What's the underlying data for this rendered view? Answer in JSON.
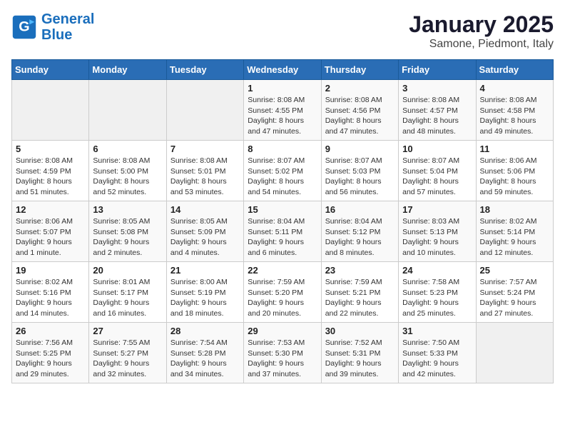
{
  "logo": {
    "line1": "General",
    "line2": "Blue"
  },
  "title": "January 2025",
  "subtitle": "Samone, Piedmont, Italy",
  "weekdays": [
    "Sunday",
    "Monday",
    "Tuesday",
    "Wednesday",
    "Thursday",
    "Friday",
    "Saturday"
  ],
  "weeks": [
    [
      {
        "day": "",
        "info": ""
      },
      {
        "day": "",
        "info": ""
      },
      {
        "day": "",
        "info": ""
      },
      {
        "day": "1",
        "info": "Sunrise: 8:08 AM\nSunset: 4:55 PM\nDaylight: 8 hours and 47 minutes."
      },
      {
        "day": "2",
        "info": "Sunrise: 8:08 AM\nSunset: 4:56 PM\nDaylight: 8 hours and 47 minutes."
      },
      {
        "day": "3",
        "info": "Sunrise: 8:08 AM\nSunset: 4:57 PM\nDaylight: 8 hours and 48 minutes."
      },
      {
        "day": "4",
        "info": "Sunrise: 8:08 AM\nSunset: 4:58 PM\nDaylight: 8 hours and 49 minutes."
      }
    ],
    [
      {
        "day": "5",
        "info": "Sunrise: 8:08 AM\nSunset: 4:59 PM\nDaylight: 8 hours and 51 minutes."
      },
      {
        "day": "6",
        "info": "Sunrise: 8:08 AM\nSunset: 5:00 PM\nDaylight: 8 hours and 52 minutes."
      },
      {
        "day": "7",
        "info": "Sunrise: 8:08 AM\nSunset: 5:01 PM\nDaylight: 8 hours and 53 minutes."
      },
      {
        "day": "8",
        "info": "Sunrise: 8:07 AM\nSunset: 5:02 PM\nDaylight: 8 hours and 54 minutes."
      },
      {
        "day": "9",
        "info": "Sunrise: 8:07 AM\nSunset: 5:03 PM\nDaylight: 8 hours and 56 minutes."
      },
      {
        "day": "10",
        "info": "Sunrise: 8:07 AM\nSunset: 5:04 PM\nDaylight: 8 hours and 57 minutes."
      },
      {
        "day": "11",
        "info": "Sunrise: 8:06 AM\nSunset: 5:06 PM\nDaylight: 8 hours and 59 minutes."
      }
    ],
    [
      {
        "day": "12",
        "info": "Sunrise: 8:06 AM\nSunset: 5:07 PM\nDaylight: 9 hours and 1 minute."
      },
      {
        "day": "13",
        "info": "Sunrise: 8:05 AM\nSunset: 5:08 PM\nDaylight: 9 hours and 2 minutes."
      },
      {
        "day": "14",
        "info": "Sunrise: 8:05 AM\nSunset: 5:09 PM\nDaylight: 9 hours and 4 minutes."
      },
      {
        "day": "15",
        "info": "Sunrise: 8:04 AM\nSunset: 5:11 PM\nDaylight: 9 hours and 6 minutes."
      },
      {
        "day": "16",
        "info": "Sunrise: 8:04 AM\nSunset: 5:12 PM\nDaylight: 9 hours and 8 minutes."
      },
      {
        "day": "17",
        "info": "Sunrise: 8:03 AM\nSunset: 5:13 PM\nDaylight: 9 hours and 10 minutes."
      },
      {
        "day": "18",
        "info": "Sunrise: 8:02 AM\nSunset: 5:14 PM\nDaylight: 9 hours and 12 minutes."
      }
    ],
    [
      {
        "day": "19",
        "info": "Sunrise: 8:02 AM\nSunset: 5:16 PM\nDaylight: 9 hours and 14 minutes."
      },
      {
        "day": "20",
        "info": "Sunrise: 8:01 AM\nSunset: 5:17 PM\nDaylight: 9 hours and 16 minutes."
      },
      {
        "day": "21",
        "info": "Sunrise: 8:00 AM\nSunset: 5:19 PM\nDaylight: 9 hours and 18 minutes."
      },
      {
        "day": "22",
        "info": "Sunrise: 7:59 AM\nSunset: 5:20 PM\nDaylight: 9 hours and 20 minutes."
      },
      {
        "day": "23",
        "info": "Sunrise: 7:59 AM\nSunset: 5:21 PM\nDaylight: 9 hours and 22 minutes."
      },
      {
        "day": "24",
        "info": "Sunrise: 7:58 AM\nSunset: 5:23 PM\nDaylight: 9 hours and 25 minutes."
      },
      {
        "day": "25",
        "info": "Sunrise: 7:57 AM\nSunset: 5:24 PM\nDaylight: 9 hours and 27 minutes."
      }
    ],
    [
      {
        "day": "26",
        "info": "Sunrise: 7:56 AM\nSunset: 5:25 PM\nDaylight: 9 hours and 29 minutes."
      },
      {
        "day": "27",
        "info": "Sunrise: 7:55 AM\nSunset: 5:27 PM\nDaylight: 9 hours and 32 minutes."
      },
      {
        "day": "28",
        "info": "Sunrise: 7:54 AM\nSunset: 5:28 PM\nDaylight: 9 hours and 34 minutes."
      },
      {
        "day": "29",
        "info": "Sunrise: 7:53 AM\nSunset: 5:30 PM\nDaylight: 9 hours and 37 minutes."
      },
      {
        "day": "30",
        "info": "Sunrise: 7:52 AM\nSunset: 5:31 PM\nDaylight: 9 hours and 39 minutes."
      },
      {
        "day": "31",
        "info": "Sunrise: 7:50 AM\nSunset: 5:33 PM\nDaylight: 9 hours and 42 minutes."
      },
      {
        "day": "",
        "info": ""
      }
    ]
  ]
}
